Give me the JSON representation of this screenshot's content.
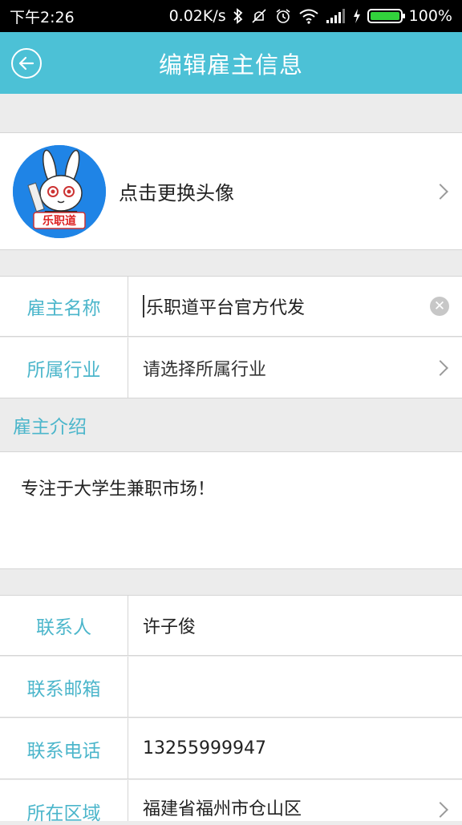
{
  "status_bar": {
    "time": "下午2:26",
    "speed": "0.02K/s",
    "battery": "100%",
    "battery_level_percent": 100
  },
  "header": {
    "title": "编辑雇主信息",
    "back_icon": "back-arrow-circle-icon"
  },
  "avatar": {
    "label": "点击更换头像",
    "logo_text": "乐职道"
  },
  "form": {
    "employer_name": {
      "label": "雇主名称",
      "value": "乐职道平台官方代发"
    },
    "industry": {
      "label": "所属行业",
      "value": "请选择所属行业"
    }
  },
  "intro": {
    "header": "雇主介绍",
    "text": "专注于大学生兼职市场！"
  },
  "contact": {
    "person": {
      "label": "联系人",
      "value": "许子俊"
    },
    "email": {
      "label": "联系邮箱",
      "value": ""
    },
    "phone": {
      "label": "联系电话",
      "value": "13255999947"
    },
    "area": {
      "label": "所在区域",
      "value": "福建省福州市仓山区"
    }
  },
  "colors": {
    "accent": "#4cc1d6",
    "label": "#4cb6cb",
    "battery": "#32d23c"
  }
}
